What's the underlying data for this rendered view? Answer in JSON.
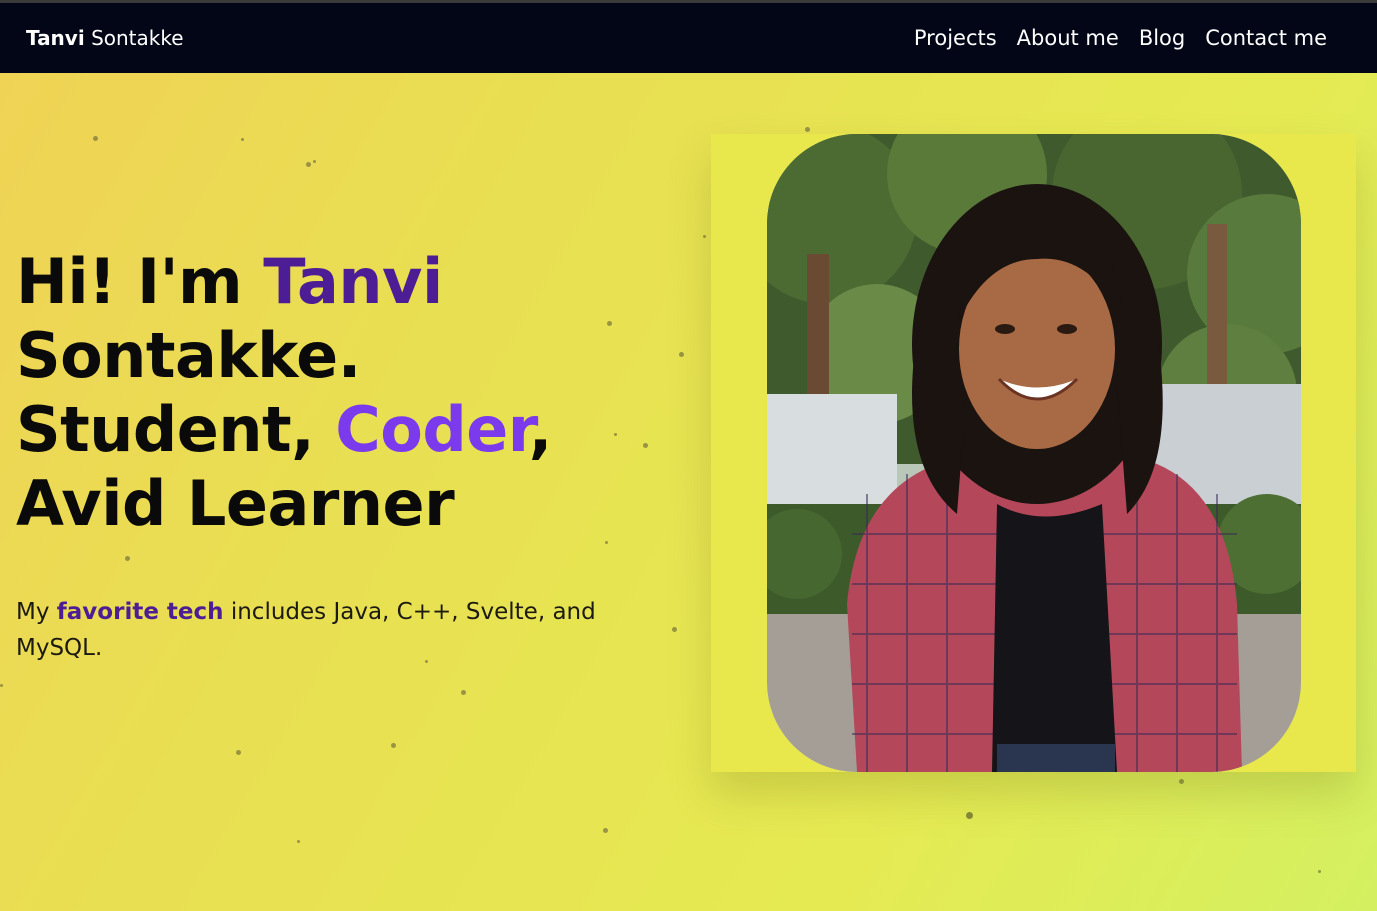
{
  "brand": {
    "first": "Tanvi",
    "last": "Sontakke"
  },
  "nav": {
    "projects": "Projects",
    "about": "About me",
    "blog": "Blog",
    "contact": "Contact me"
  },
  "hero": {
    "hi": "Hi! I'm ",
    "name_first": "Tanvi",
    "name_last": "Sontakke.",
    "student": "Student, ",
    "coder": "Coder",
    "comma": ",",
    "learner": "Avid Learner",
    "tag_prefix": "My ",
    "tag_highlight": "favorite tech",
    "tag_rest": " includes Java, C++, Svelte, and MySQL."
  },
  "colors": {
    "navbar_bg": "#020617",
    "accent_dark_purple": "#4c1d95",
    "accent_light_purple": "#7c3aed",
    "background_yellow": "#e6ea52"
  }
}
